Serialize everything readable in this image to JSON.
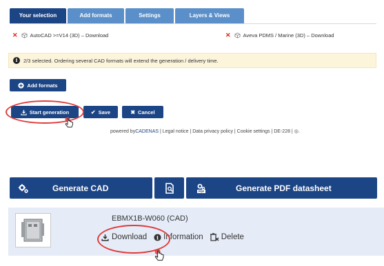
{
  "tabs": [
    {
      "label": "Your selection",
      "active": true
    },
    {
      "label": "Add formats",
      "active": false
    },
    {
      "label": "Settings",
      "active": false
    },
    {
      "label": "Layers & Views",
      "active": false
    }
  ],
  "selected_formats": [
    {
      "label": "AutoCAD >=V14 (3D) – Download"
    },
    {
      "label": "Aveva PDMS / Marine (3D) – Download"
    }
  ],
  "info_bar": {
    "icon": "info-icon",
    "text": "2/3 selected.  Ordering several CAD formats will extend the generation / delivery time."
  },
  "buttons": {
    "add_formats": "Add formats",
    "start_generation": "Start generation",
    "save": "Save",
    "cancel": "Cancel"
  },
  "footer": {
    "powered_by": "powered by",
    "brand": "CADENAS",
    "links": "| Legal notice | Data privacy policy | Cookie settings | DE-228  |"
  },
  "actions": {
    "generate_cad": "Generate CAD",
    "generate_pdf": "Generate PDF datasheet"
  },
  "result": {
    "name": "EBMX1B-W060 (CAD)",
    "download": "Download",
    "information": "Information",
    "delete": "Delete"
  },
  "colors": {
    "primary": "#1c4585",
    "tab_inactive": "#5b8fc9",
    "highlight_circle": "#e03a3a",
    "remove_x": "#d9230f",
    "info_bg": "#fcf5dc",
    "row_bg": "#e5ecf7"
  }
}
